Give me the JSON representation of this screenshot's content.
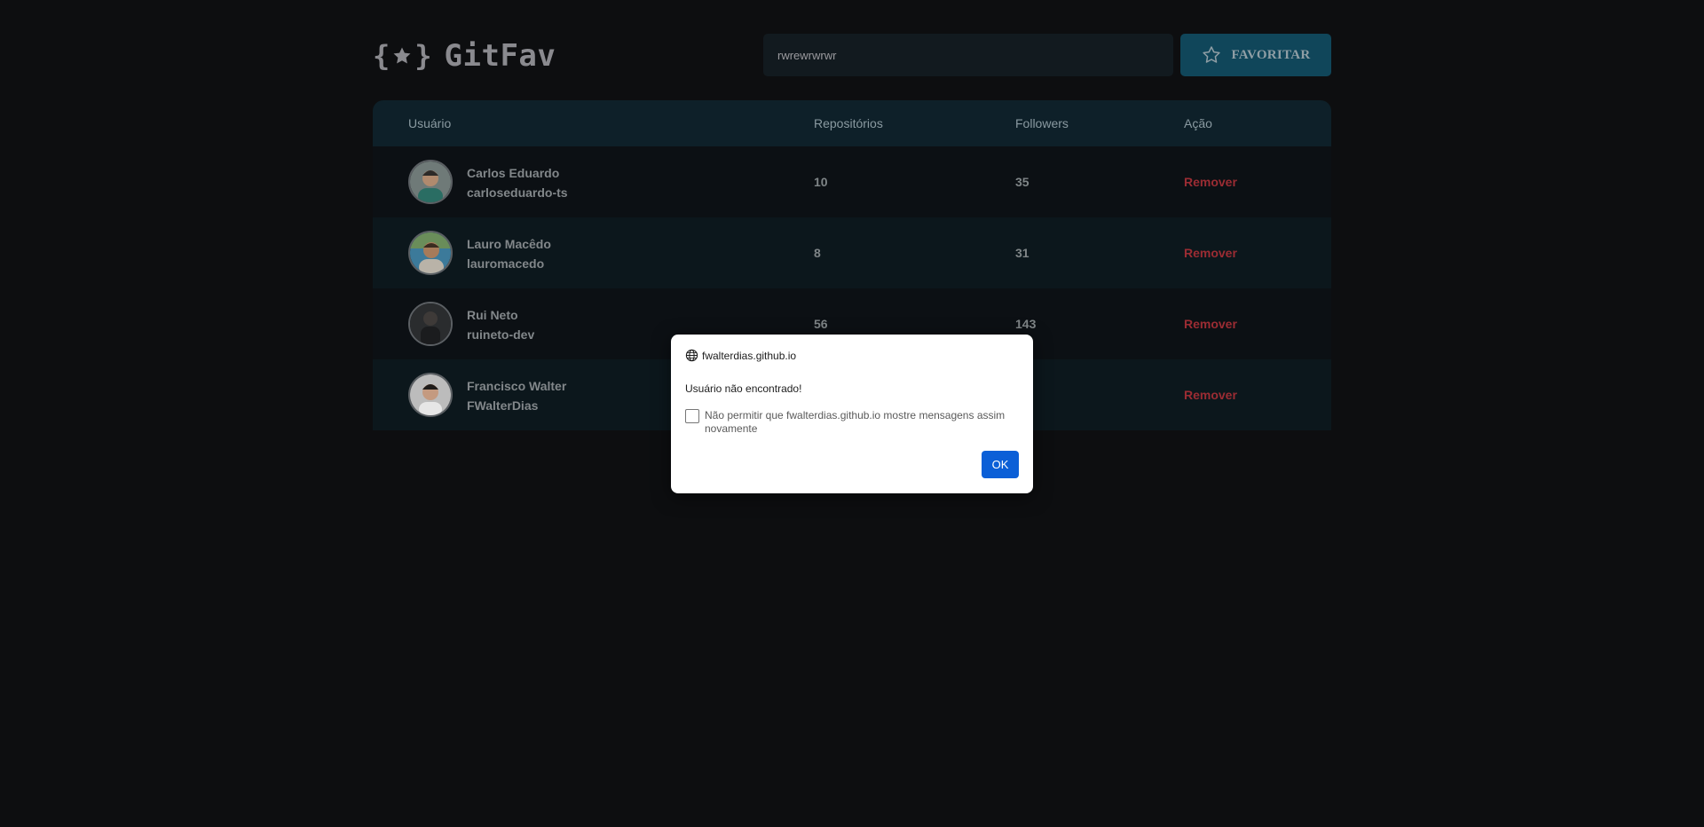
{
  "app": {
    "title": "GitFav",
    "brace_open": "{",
    "brace_close": "}",
    "logo_icon": "star-icon"
  },
  "search": {
    "value": "rwrewrwrwr"
  },
  "favorite_button": {
    "label": "FAVORITAR",
    "icon": "star-outline-icon"
  },
  "table": {
    "headers": {
      "user": "Usuário",
      "repos": "Repositórios",
      "followers": "Followers",
      "action": "Ação"
    },
    "rows": [
      {
        "name": "Carlos Eduardo",
        "login": "carloseduardo-ts",
        "repos": "10",
        "followers": "35",
        "action": "Remover"
      },
      {
        "name": "Lauro Macêdo",
        "login": "lauromacedo",
        "repos": "8",
        "followers": "31",
        "action": "Remover"
      },
      {
        "name": "Rui Neto",
        "login": "ruineto-dev",
        "repos": "56",
        "followers": "143",
        "action": "Remover"
      },
      {
        "name": "Francisco Walter",
        "login": "FWalterDias",
        "repos": "",
        "followers": "",
        "action": "Remover"
      }
    ]
  },
  "dialog": {
    "origin": "fwalterdias.github.io",
    "message": "Usuário não encontrado!",
    "checkbox_label": "Não permitir que fwalterdias.github.io mostre mensagens assim novamente",
    "ok_label": "OK"
  },
  "colors": {
    "background": "#0d0e10",
    "accent": "#10465a",
    "remove": "#9b2c33",
    "dialog_button": "#0b5fd7"
  }
}
